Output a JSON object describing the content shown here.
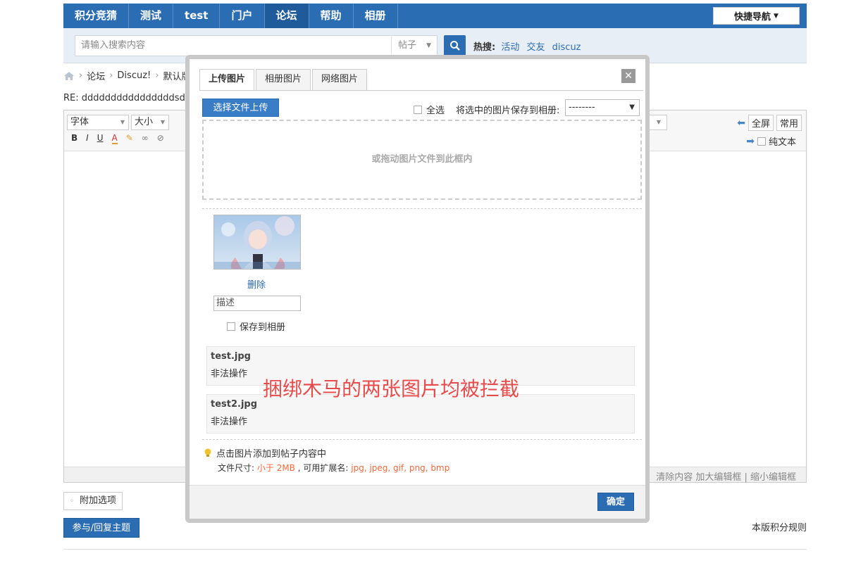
{
  "nav": {
    "items": [
      "积分竞猜",
      "测试",
      "test",
      "门户",
      "论坛",
      "帮助",
      "相册"
    ],
    "active_index": 4,
    "quick_nav_label": "快捷导航"
  },
  "search": {
    "placeholder": "请输入搜索内容",
    "type_label": "帖子",
    "hot_label": "热搜:",
    "hot_links": [
      "活动",
      "交友",
      "discuz"
    ]
  },
  "breadcrumb": {
    "items": [
      "论坛",
      "Discuz!",
      "默认版"
    ]
  },
  "thread_title": "RE: ddddddddddddddddsdf [修",
  "editor": {
    "font_label": "字体",
    "size_label": "大小",
    "fmt_buttons": [
      "B",
      "I",
      "U",
      "A"
    ],
    "fullscreen_label": "全屏",
    "common_label": "常用",
    "plaintext_label": "纯文本",
    "footer_links": "清除内容   加大编辑框 | 缩小编辑框"
  },
  "extra_options_label": "附加选项",
  "reply_button_label": "参与/回复主题",
  "rules_link_label": "本版积分规则",
  "dialog": {
    "tabs": [
      "上传图片",
      "相册图片",
      "网络图片"
    ],
    "active_tab": 0,
    "upload_button": "选择文件上传",
    "select_all_label": "全选",
    "save_to_album_prompt": "将选中的图片保存到相册:",
    "album_select_value": "--------",
    "dropzone_text": "或拖动图片文件到此框内",
    "delete_link": "删除",
    "desc_placeholder": "描述",
    "save_album_label": "保存到相册",
    "errors": [
      {
        "name": "test.jpg",
        "msg": "非法操作"
      },
      {
        "name": "test2.jpg",
        "msg": "非法操作"
      }
    ],
    "annotation": "捆绑木马的两张图片均被拦截",
    "tip_line1": "点击图片添加到帖子内容中",
    "tip_size_label": "文件尺寸:",
    "tip_size_value": "小于 2MB",
    "tip_ext_label": ", 可用扩展名:",
    "tip_ext_value": "jpg, jpeg, gif, png, bmp",
    "ok_button": "确定"
  }
}
